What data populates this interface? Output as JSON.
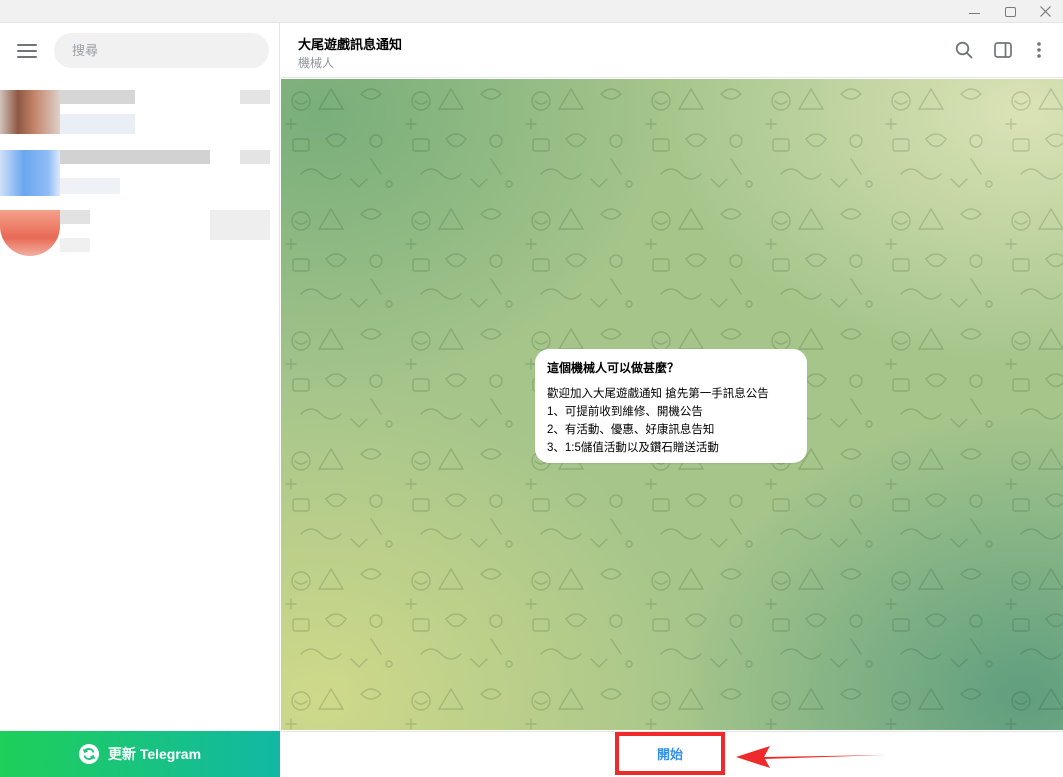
{
  "window": {
    "minimize_icon": "minimize-icon",
    "maximize_icon": "maximize-icon",
    "close_icon": "close-icon"
  },
  "sidebar": {
    "search_placeholder": "搜尋",
    "update_label": "更新 Telegram",
    "update_icon": "refresh-icon"
  },
  "chat": {
    "title": "大尾遊戲訊息通知",
    "subtitle": "機械人",
    "header_icons": [
      "search-icon",
      "sidebar-toggle-icon",
      "more-vertical-icon"
    ]
  },
  "bubble": {
    "title": "這個機械人可以做甚麼？",
    "lines": [
      "歡迎加入大尾遊戲通知 搶先第一手訊息公告",
      "1、可提前收到維修、開機公告",
      "2、有活動、優惠、好康訊息告知",
      "3、1:5儲值活動以及鑽石贈送活動"
    ]
  },
  "bottom": {
    "start_label": "開始"
  },
  "colors": {
    "accent": "#3390ec",
    "highlight": "#ee2a2a",
    "update_gradient_start": "#1fcf58",
    "update_gradient_end": "#12b8a4"
  }
}
